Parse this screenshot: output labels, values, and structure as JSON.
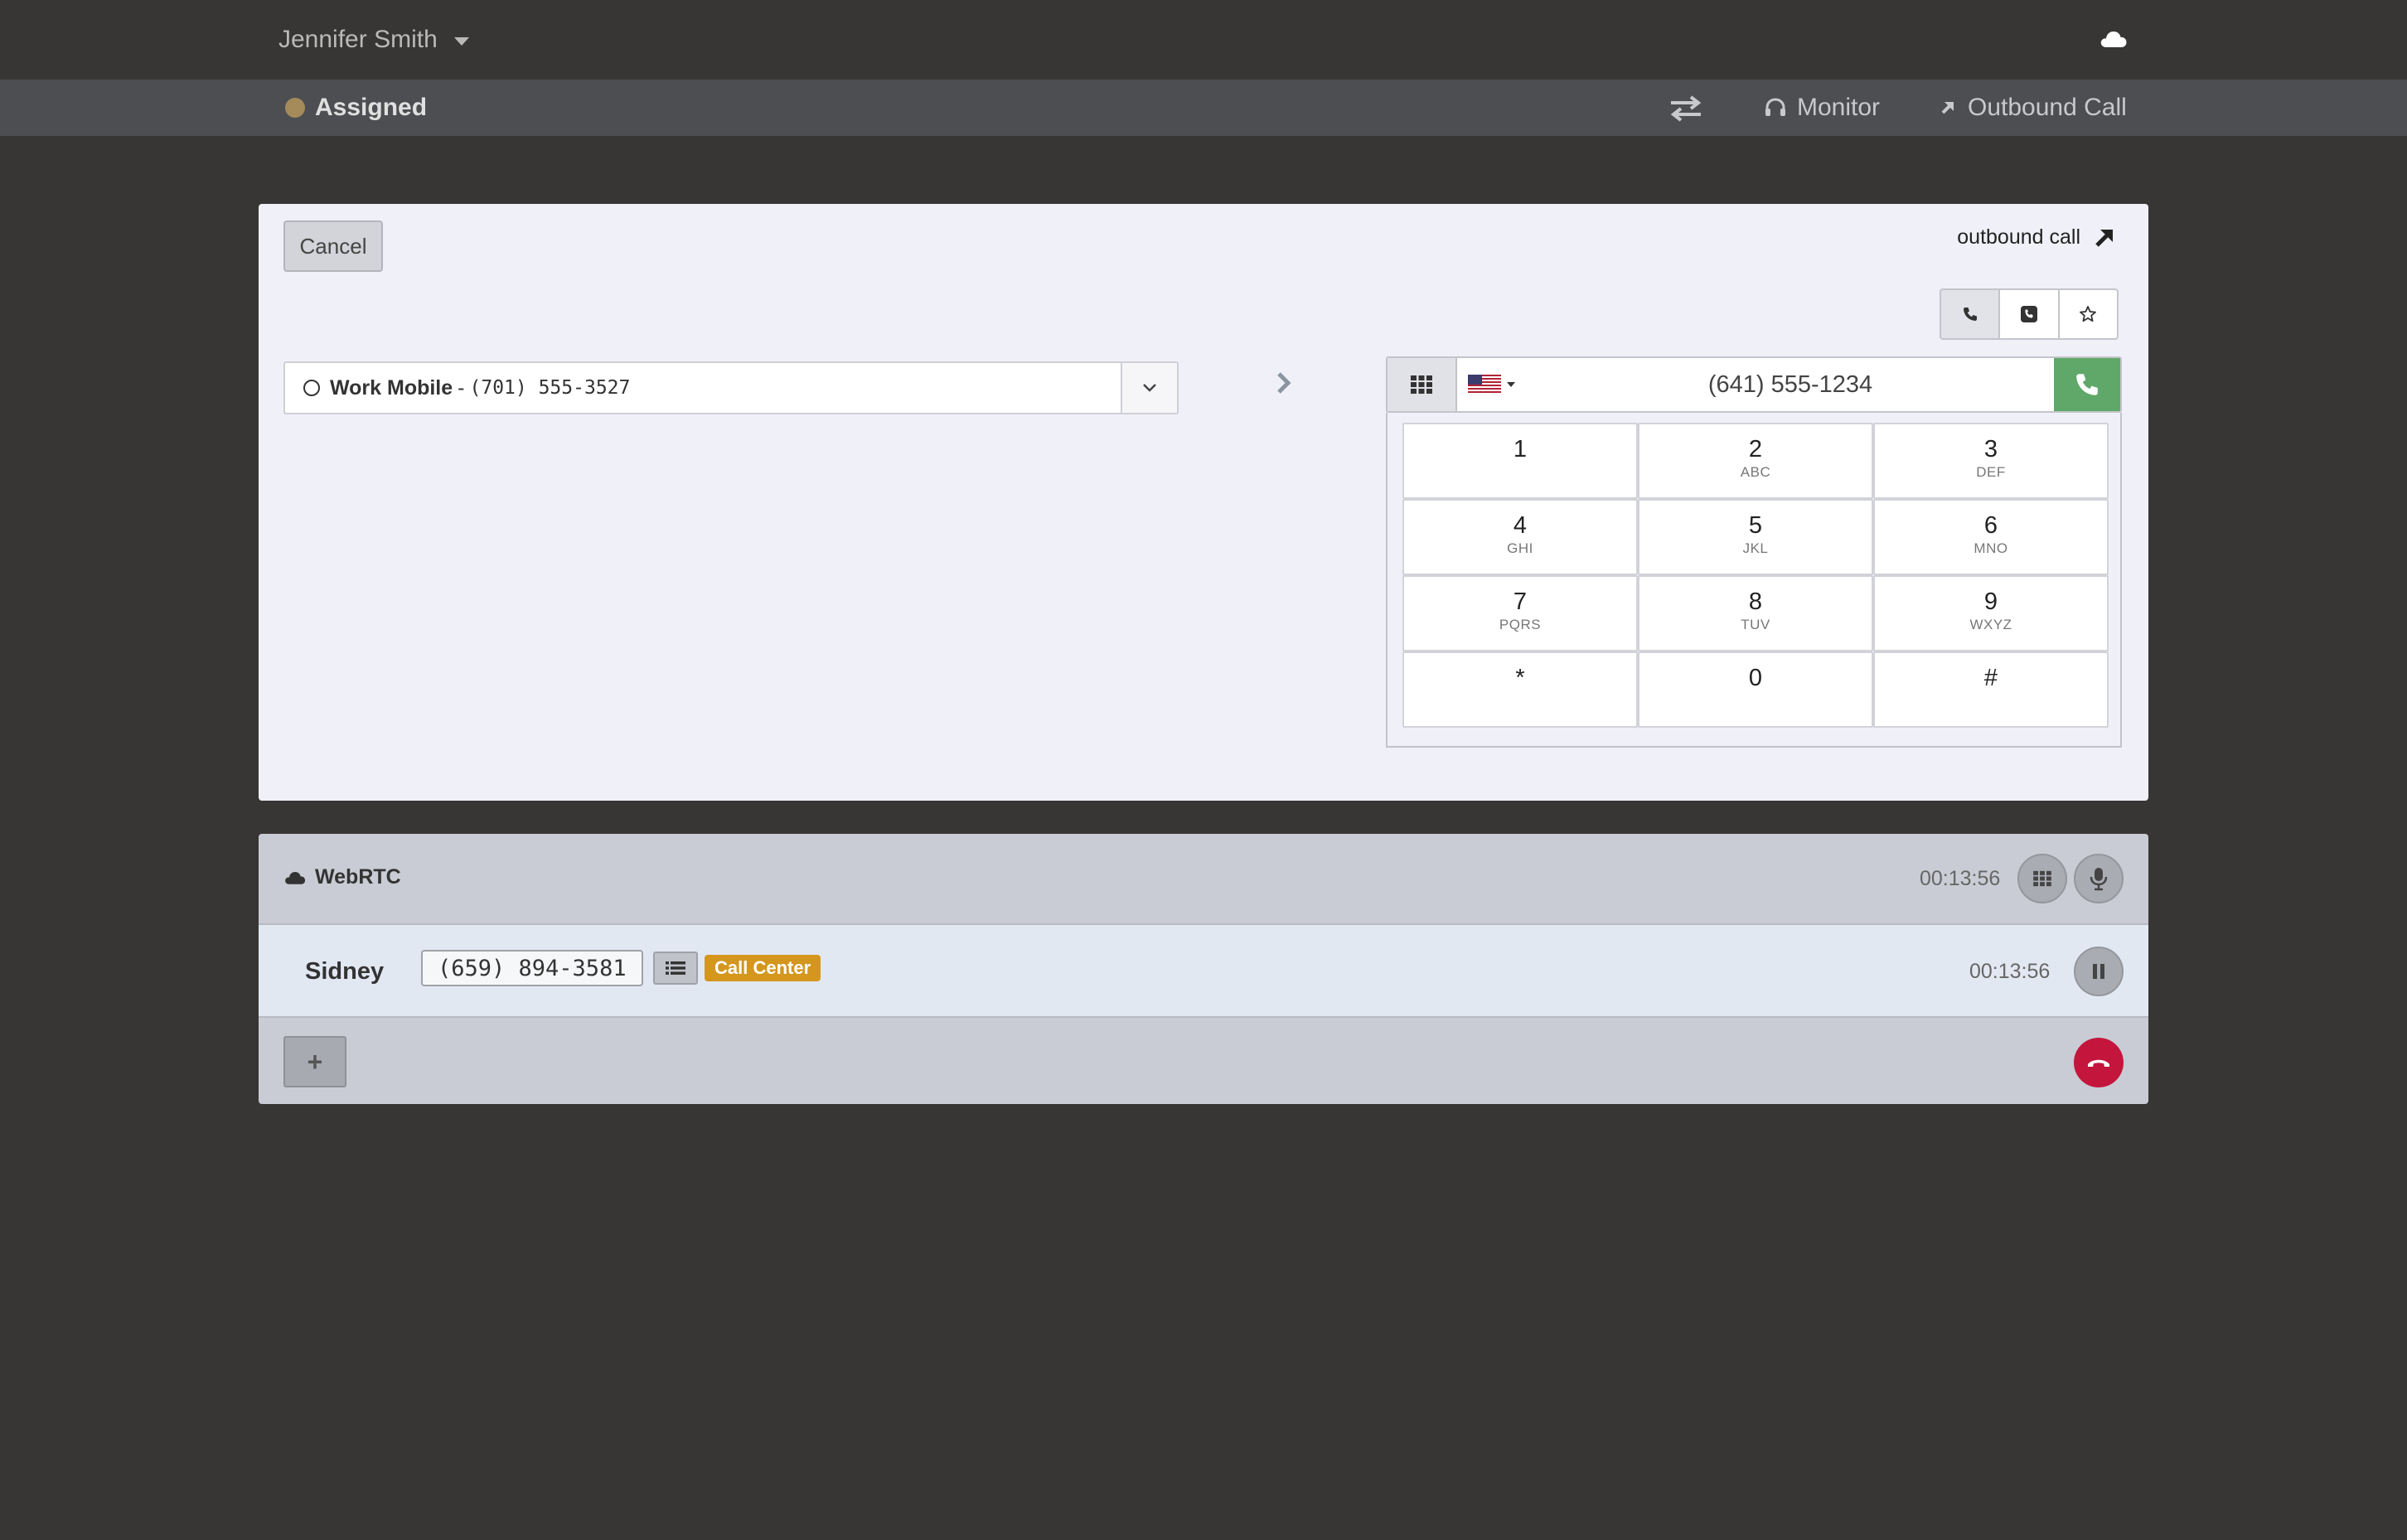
{
  "header": {
    "user_name": "Jennifer Smith",
    "cloud_icon": "cloud-icon"
  },
  "status_bar": {
    "status": "Assigned",
    "status_color": "#a58b5a",
    "monitor_label": "Monitor",
    "outbound_label": "Outbound Call"
  },
  "outbound_panel": {
    "cancel_label": "Cancel",
    "title": "outbound call",
    "modes": [
      "phone-icon",
      "phone-square-icon",
      "star-icon"
    ],
    "from_number": {
      "label": "Work Mobile",
      "separator": "-",
      "number": "(701) 555-3527"
    },
    "dial_number": "(641) 555-1234",
    "country": "US",
    "keys": [
      {
        "digit": "1",
        "letters": ""
      },
      {
        "digit": "2",
        "letters": "ABC"
      },
      {
        "digit": "3",
        "letters": "DEF"
      },
      {
        "digit": "4",
        "letters": "GHI"
      },
      {
        "digit": "5",
        "letters": "JKL"
      },
      {
        "digit": "6",
        "letters": "MNO"
      },
      {
        "digit": "7",
        "letters": "PQRS"
      },
      {
        "digit": "8",
        "letters": "TUV"
      },
      {
        "digit": "9",
        "letters": "WXYZ"
      },
      {
        "digit": "*",
        "letters": ""
      },
      {
        "digit": "0",
        "letters": ""
      },
      {
        "digit": "#",
        "letters": ""
      }
    ],
    "call_color": "#5fa869"
  },
  "webrtc": {
    "title": "WebRTC",
    "timer": "00:13:56",
    "caller": {
      "name": "Sidney",
      "number": "(659) 894-3581",
      "queue": "Call Center",
      "queue_color": "#d4961d",
      "timer": "00:13:56"
    },
    "add_label": "+",
    "hangup_color": "#c4163c"
  }
}
